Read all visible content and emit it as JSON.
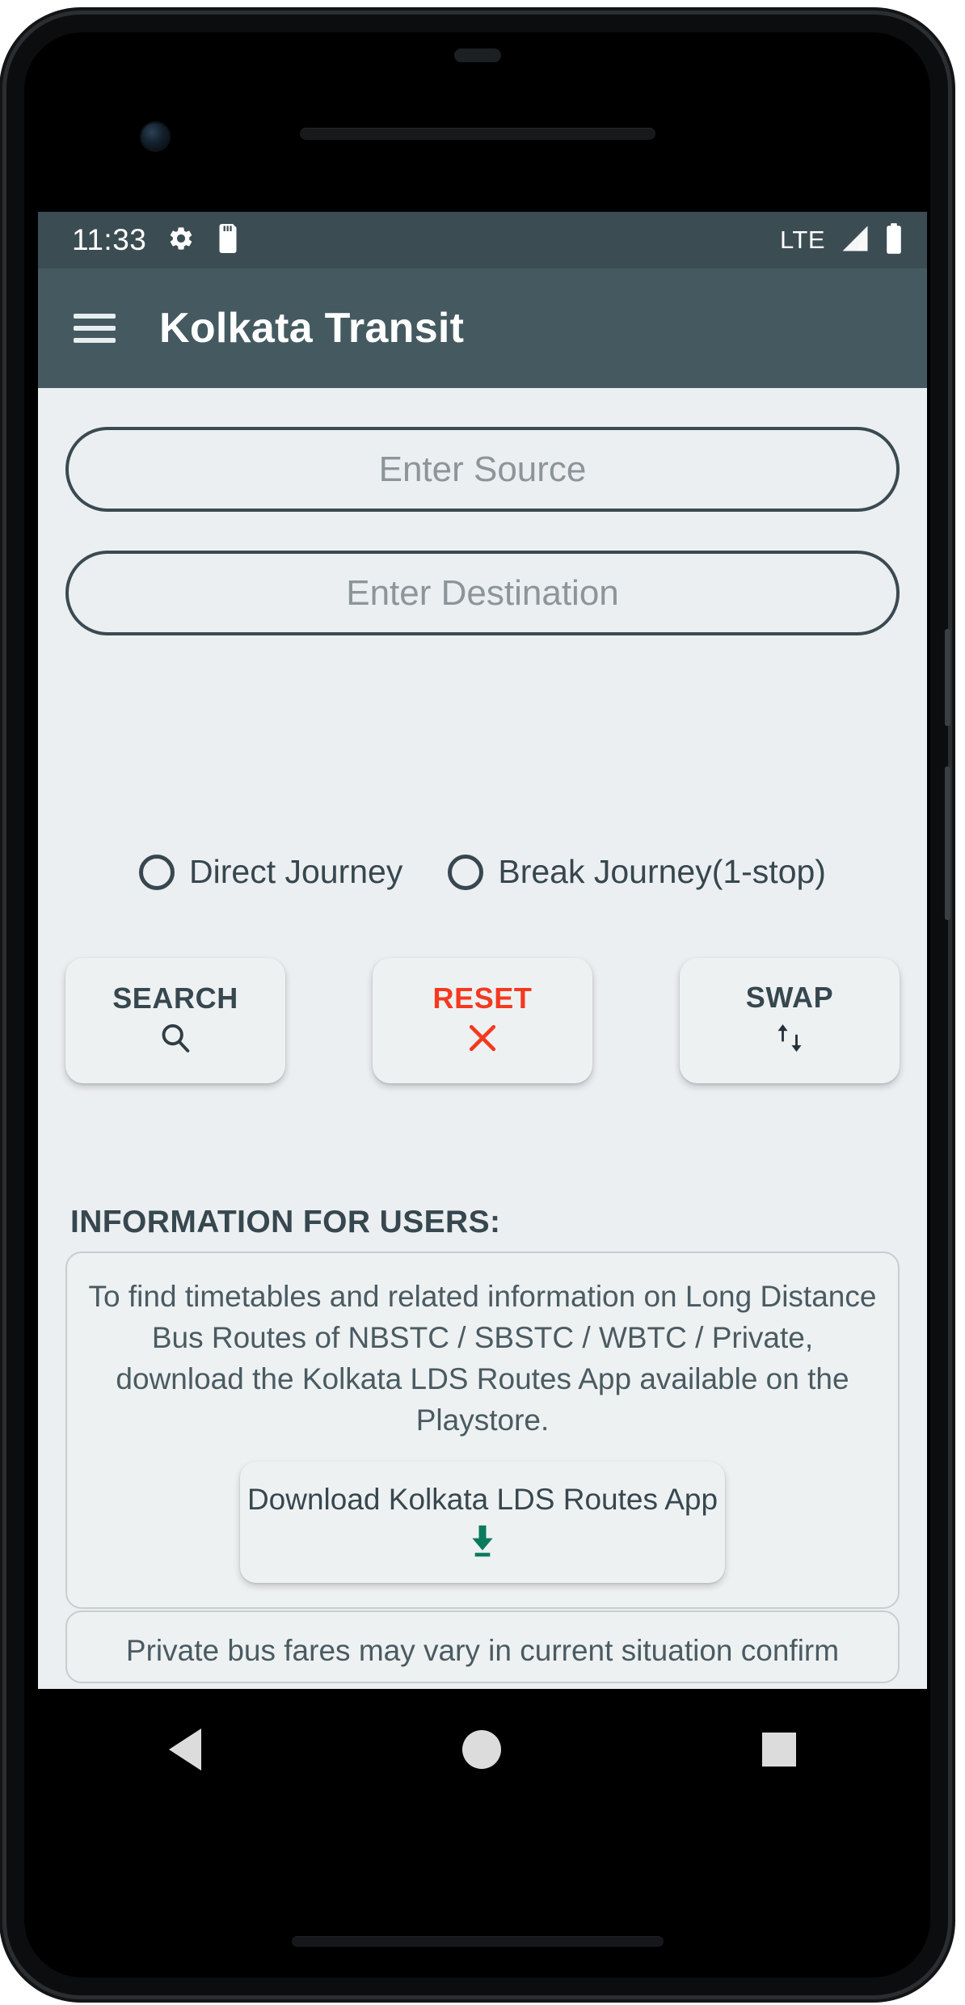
{
  "status_bar": {
    "time": "11:33",
    "icons_left": [
      "gear-icon",
      "sd-card-icon"
    ],
    "network": "LTE",
    "icons_right": [
      "signal-bars-icon",
      "battery-icon"
    ],
    "background": "#3c4c53"
  },
  "app_bar": {
    "menu_icon": "hamburger-menu-icon",
    "title": "Kolkata Transit",
    "background": "#455a60"
  },
  "form": {
    "source": {
      "value": "",
      "placeholder": "Enter Source"
    },
    "destination": {
      "value": "",
      "placeholder": "Enter Destination"
    }
  },
  "journey_type": {
    "options": [
      {
        "label": "Direct Journey",
        "selected": false
      },
      {
        "label": "Break Journey(1-stop)",
        "selected": false
      }
    ]
  },
  "actions": [
    {
      "label": "SEARCH",
      "icon": "search-icon",
      "color": "#37474f"
    },
    {
      "label": "RESET",
      "icon": "close-x-icon",
      "color": "#f4391f"
    },
    {
      "label": "SWAP",
      "icon": "swap-arrows-icon",
      "color": "#37474f"
    }
  ],
  "information": {
    "heading": "INFORMATION FOR USERS:",
    "card1": {
      "text": "To find timetables and related information on Long Distance Bus Routes of NBSTC / SBSTC / WBTC / Private, download the Kolkata LDS Routes App available on the Playstore.",
      "button": {
        "label": "Download Kolkata LDS Routes App",
        "icon": "download-icon",
        "icon_color": "#0b7a5e"
      }
    },
    "card2": {
      "text": "Private bus fares may vary in current situation confirm"
    }
  },
  "nav_bar": {
    "back": "back-triangle-icon",
    "home": "home-circle-icon",
    "recents": "recents-square-icon"
  },
  "colors": {
    "screen_bg": "#eceff1",
    "accent_dark": "#37474f",
    "danger": "#f4391f",
    "download_green": "#0b7a5e"
  }
}
